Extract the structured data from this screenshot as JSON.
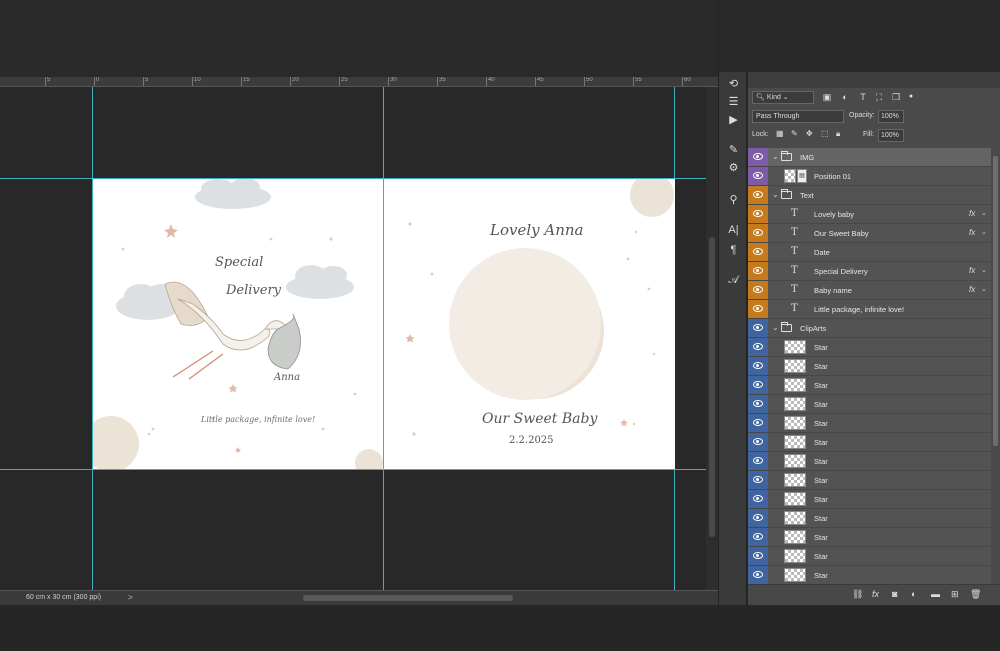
{
  "status": {
    "doc_size": "60 cm x 30 cm (300 ppi)",
    "arrow": ">"
  },
  "ruler": {
    "labels": [
      "5",
      "0",
      "5",
      "10",
      "15",
      "20",
      "25",
      "30",
      "35",
      "40",
      "45",
      "50",
      "55",
      "60"
    ]
  },
  "document": {
    "left_page": {
      "title_line1": "Special",
      "title_line2": "Delivery",
      "bag_name": "Anna",
      "tagline": "Little package, infinite love!"
    },
    "right_page": {
      "heading": "Lovely Anna",
      "subtitle": "Our Sweet Baby",
      "date": "2.2.2025"
    }
  },
  "tools": [
    "rotate-view-icon",
    "adjust-icon",
    "play-icon",
    "brush-settings-icon",
    "adjustments-icon",
    "stamp-icon",
    "character-icon",
    "paragraph-icon",
    "glyphs-icon"
  ],
  "tool_glyphs": [
    "⟲",
    "☰",
    "▶",
    "✎",
    "⚙",
    "⚲",
    "A|",
    "¶",
    "𝒜"
  ],
  "layers_panel": {
    "filter_kind": "Kind",
    "blend_mode": "Pass Through",
    "opacity_label": "Opacity:",
    "opacity_value": "100%",
    "lock_label": "Lock:",
    "fill_label": "Fill:",
    "fill_value": "100%",
    "fx_glyph": "fx",
    "layers": [
      {
        "name": "IMG",
        "kind": "group",
        "color": "purple",
        "selected": true
      },
      {
        "name": "Position 01",
        "kind": "smart",
        "color": "purple"
      },
      {
        "name": "Text",
        "kind": "group",
        "color": "orange"
      },
      {
        "name": "Lovely baby",
        "kind": "text",
        "color": "orange",
        "fx": true
      },
      {
        "name": "Our Sweet Baby",
        "kind": "text",
        "color": "orange",
        "fx": true
      },
      {
        "name": "Date",
        "kind": "text",
        "color": "orange"
      },
      {
        "name": "Special Delivery",
        "kind": "text",
        "color": "orange",
        "fx": true
      },
      {
        "name": "Baby name",
        "kind": "text",
        "color": "orange",
        "fx": true
      },
      {
        "name": "Little package, infinite love!",
        "kind": "text",
        "color": "orange"
      },
      {
        "name": "ClipArts",
        "kind": "group",
        "color": "blue"
      },
      {
        "name": "Star",
        "kind": "pixel",
        "color": "blue"
      },
      {
        "name": "Star",
        "kind": "pixel",
        "color": "blue"
      },
      {
        "name": "Star",
        "kind": "pixel",
        "color": "blue"
      },
      {
        "name": "Star",
        "kind": "pixel",
        "color": "blue"
      },
      {
        "name": "Star",
        "kind": "pixel",
        "color": "blue"
      },
      {
        "name": "Star",
        "kind": "pixel",
        "color": "blue"
      },
      {
        "name": "Star",
        "kind": "pixel",
        "color": "blue"
      },
      {
        "name": "Star",
        "kind": "pixel",
        "color": "blue"
      },
      {
        "name": "Star",
        "kind": "pixel",
        "color": "blue"
      },
      {
        "name": "Star",
        "kind": "pixel",
        "color": "blue"
      },
      {
        "name": "Star",
        "kind": "pixel",
        "color": "blue"
      },
      {
        "name": "Star",
        "kind": "pixel",
        "color": "blue"
      },
      {
        "name": "Star",
        "kind": "pixel",
        "color": "blue"
      }
    ]
  },
  "colors": {
    "guide": "#3fc6d8",
    "purple": "#7e5ba6",
    "orange": "#c47a1d",
    "blue": "#3f64a0"
  }
}
